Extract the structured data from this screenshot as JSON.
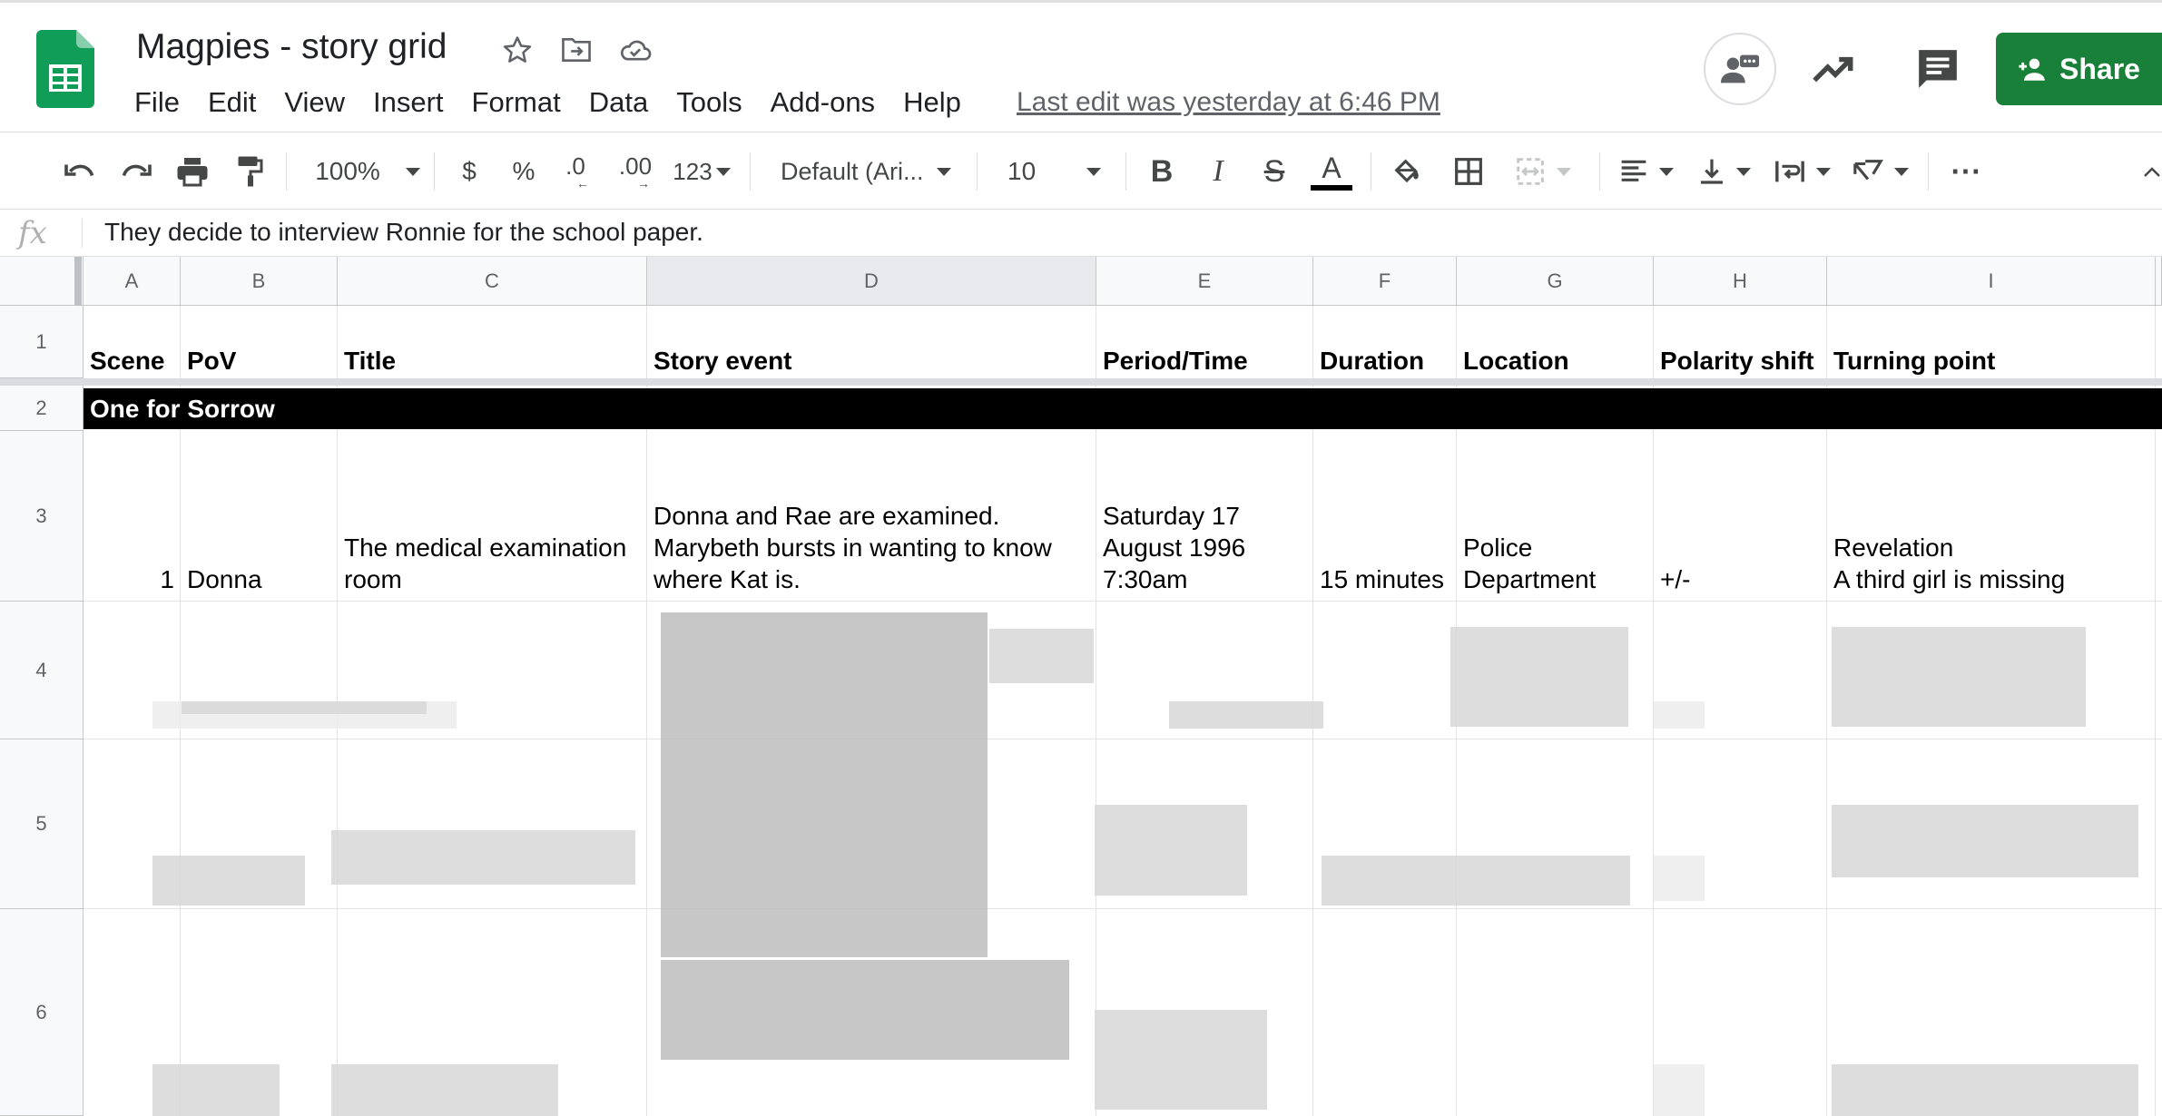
{
  "app": {
    "doc_title": "Magpies - story grid",
    "menu": [
      "File",
      "Edit",
      "View",
      "Insert",
      "Format",
      "Data",
      "Tools",
      "Add-ons",
      "Help"
    ],
    "last_edit": "Last edit was yesterday at 6:46 PM",
    "share_label": "Share",
    "accent_color": "#188038"
  },
  "toolbar": {
    "zoom": "100%",
    "currency": "$",
    "percent": "%",
    "decrease_decimals": ".0",
    "increase_decimals": ".00",
    "more_formats": "123",
    "font_family": "Default (Ari...",
    "font_size": "10",
    "bold": "B",
    "italic": "I",
    "strikethrough": "S",
    "text_color": "A",
    "more": "⋯"
  },
  "formula_bar": {
    "fx": "fx",
    "value": "They decide to interview Ronnie for the school paper."
  },
  "grid": {
    "columns": [
      "A",
      "B",
      "C",
      "D",
      "E",
      "F",
      "G",
      "H",
      "I"
    ],
    "rows": [
      "1",
      "2",
      "3",
      "4",
      "5",
      "6"
    ],
    "header_row": [
      "Scene",
      "PoV",
      "Title",
      "Story event",
      "Period/Time",
      "Duration",
      "Location",
      "Polarity shift",
      "Turning point"
    ],
    "section_title": "One for Sorrow",
    "row3": {
      "scene": "1",
      "pov": "Donna",
      "title_line1": "The medical examination",
      "title_line2": "room",
      "event_line1": "Donna and Rae are examined.",
      "event_line2": "Marybeth bursts in wanting to know",
      "event_line3": "where Kat is.",
      "time_line1": "Saturday 17",
      "time_line2": "August 1996",
      "time_line3": "7:30am",
      "duration": "15 minutes",
      "location_line1": "Police",
      "location_line2": "Department",
      "polarity": "+/-",
      "turning_line1": "Revelation",
      "turning_line2": "A third girl is missing"
    }
  }
}
